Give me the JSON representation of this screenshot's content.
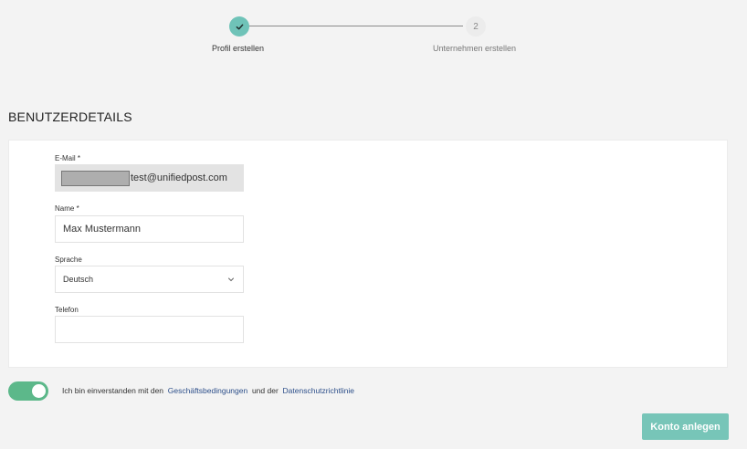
{
  "stepper": {
    "step1": {
      "label": "Profil erstellen",
      "status": "completed",
      "icon": "check-icon"
    },
    "step2": {
      "number": "2",
      "label": "Unternehmen erstellen",
      "status": "pending"
    }
  },
  "section": {
    "title": "BENUTZERDETAILS"
  },
  "form": {
    "email": {
      "label": "E-Mail *",
      "value": "test@unifiedpost.com",
      "readonly": true
    },
    "name": {
      "label": "Name *",
      "value": "Max Mustermann"
    },
    "language": {
      "label": "Sprache",
      "value": "Deutsch"
    },
    "phone": {
      "label": "Telefon",
      "value": ""
    }
  },
  "consent": {
    "enabled": true,
    "prefix": "Ich bin einverstanden mit den",
    "terms_link": "Geschäftsbedingungen",
    "middle": "und der",
    "privacy_link": "Datenschutzrichtlinie"
  },
  "actions": {
    "submit_label": "Konto anlegen"
  },
  "colors": {
    "accent": "#77c5b8",
    "toggle": "#5cb88a",
    "link": "#2d4f8a"
  }
}
